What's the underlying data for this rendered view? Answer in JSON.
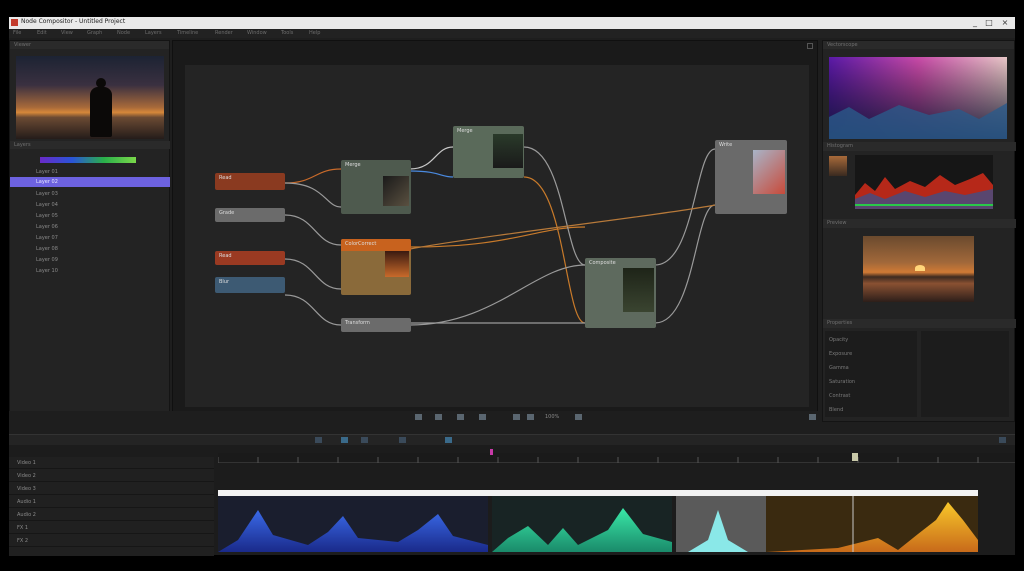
{
  "window": {
    "title": "Node Compositor - Untitled Project",
    "buttons": [
      "_",
      "□",
      "×"
    ]
  },
  "menu": [
    "File",
    "Edit",
    "View",
    "Graph",
    "Node",
    "Layers",
    "Timeline",
    "Render",
    "Window",
    "Tools",
    "Help"
  ],
  "left_panel": {
    "title": "Viewer",
    "layers_title": "Layers",
    "layers": [
      "Layer 01",
      "Layer 02",
      "Layer 03",
      "Layer 04",
      "Layer 05",
      "Layer 06",
      "Layer 07",
      "Layer 08",
      "Layer 09",
      "Layer 10"
    ]
  },
  "node_graph": {
    "nodes": [
      {
        "label": "Read",
        "color": "#b84a2a"
      },
      {
        "label": "Grade",
        "color": "#7a7a7a"
      },
      {
        "label": "Read",
        "color": "#b84a2a"
      },
      {
        "label": "Blur",
        "color": "#4e6880"
      },
      {
        "label": "Merge",
        "color": "#687a6a"
      },
      {
        "label": "ColorCorrect",
        "color": "#c8621e"
      },
      {
        "label": "Merge",
        "color": "#687a6a"
      },
      {
        "label": "Transform",
        "color": "#7a7a7a"
      },
      {
        "label": "Composite",
        "color": "#6d7a6d"
      },
      {
        "label": "Write",
        "color": "#7a7a7a"
      }
    ],
    "toolbar_zoom": "100%"
  },
  "right_panel": {
    "scope_title": "Vectorscope",
    "histo_title": "Histogram",
    "preview_title": "Preview",
    "props_title": "Properties",
    "properties": [
      "Opacity",
      "Exposure",
      "Gamma",
      "Saturation",
      "Contrast",
      "Blend"
    ]
  },
  "timeline": {
    "tracks": [
      "Video 1",
      "Video 2",
      "Video 3",
      "Audio 1",
      "Audio 2",
      "FX 1",
      "FX 2"
    ],
    "playhead_color": "#c8c8c8"
  },
  "colors": {
    "accent": "#6d62e0",
    "node_read": "#b84a2a",
    "node_blur": "#4e6880"
  }
}
